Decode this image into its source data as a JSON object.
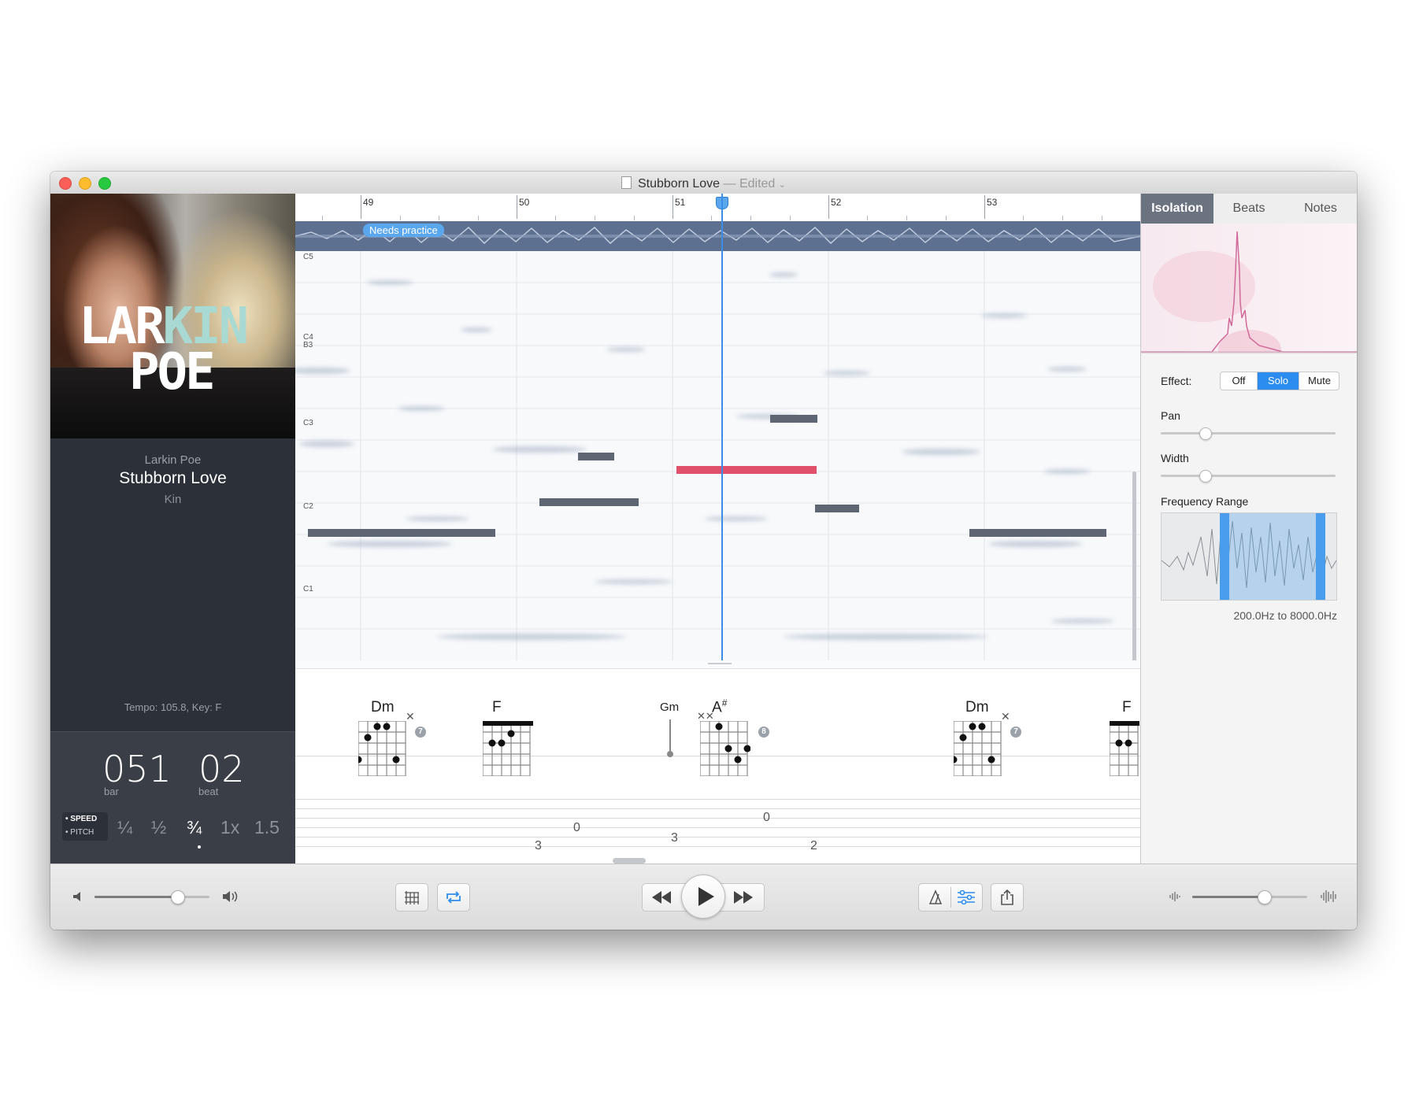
{
  "window": {
    "title": "Stubborn Love",
    "edited_label": "— Edited",
    "title_chevron": "⌄"
  },
  "album": {
    "art_line1_a": "LAR",
    "art_line1_b": "KIN",
    "art_line2": "POE",
    "accent_color": "#a8dad3"
  },
  "track": {
    "artist": "Larkin Poe",
    "title": "Stubborn Love",
    "album": "Kin",
    "tempo_key": "Tempo: 105.8, Key: F"
  },
  "position": {
    "bar": "051",
    "bar_label": "bar",
    "beat": "02",
    "beat_label": "beat"
  },
  "speed_pitch": {
    "speed_label": "SPEED",
    "pitch_label": "PITCH",
    "options": [
      "¼",
      "½",
      "¾",
      "1x",
      "1.5"
    ],
    "selected": "¾"
  },
  "ruler": {
    "bars": [
      "49",
      "50",
      "51",
      "52",
      "53"
    ]
  },
  "marker": {
    "label": "Needs practice"
  },
  "pitch_labels": [
    "C5",
    "C4",
    "B3",
    "C3",
    "C2",
    "C1"
  ],
  "chords": [
    {
      "name": "Dm",
      "fret": "7"
    },
    {
      "name": "F",
      "fret": ""
    },
    {
      "name": "Gm",
      "fret": ""
    },
    {
      "name": "A",
      "sup": "#",
      "fret": "8"
    },
    {
      "name": "Dm",
      "fret": "7"
    },
    {
      "name": "F",
      "fret": ""
    }
  ],
  "tab_numbers": [
    "3",
    "0",
    "3",
    "0",
    "2"
  ],
  "right_panel": {
    "tabs": [
      "Isolation",
      "Beats",
      "Notes"
    ],
    "selected_tab": "Isolation",
    "effect_label": "Effect:",
    "effect_options": [
      "Off",
      "Solo",
      "Mute"
    ],
    "effect_selected": "Solo",
    "pan_label": "Pan",
    "pan_value": 0.25,
    "width_label": "Width",
    "width_value": 0.25,
    "freq_label": "Frequency Range",
    "freq_text": "200.0Hz to 8000.0Hz"
  },
  "toolbar": {
    "volume_value": 0.72,
    "mix_value": 0.62,
    "icons": [
      "speaker-low-icon",
      "speaker-high-icon",
      "grid-icon",
      "loop-icon",
      "rewind-icon",
      "play-icon",
      "fast-forward-icon",
      "tuner-icon",
      "mixer-icon",
      "share-icon",
      "waveform-small-icon",
      "waveform-large-icon"
    ],
    "accent": "#2d8cf0"
  }
}
